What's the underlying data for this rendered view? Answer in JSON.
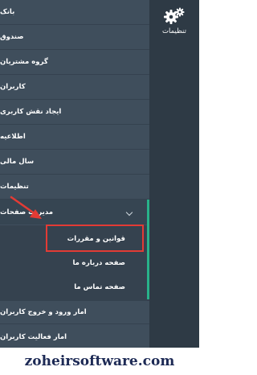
{
  "rail": {
    "icon": "gears-icon",
    "label": "تنظیمات"
  },
  "menu": {
    "items": [
      {
        "label": "بانک"
      },
      {
        "label": "صندوق"
      },
      {
        "label": "گروه مشتریان"
      },
      {
        "label": "کاربران"
      },
      {
        "label": "ایجاد نقش کاربری"
      },
      {
        "label": "اطلاعیه"
      },
      {
        "label": "سال مالی"
      },
      {
        "label": "تنظیمات"
      }
    ],
    "parent": {
      "label": "مدیریت صفحات",
      "icon": "chevron-down-icon"
    },
    "subitems": [
      {
        "label": "قوانین و مقررات"
      },
      {
        "label": "صفحه درباره ما"
      },
      {
        "label": "صفحه تماس ما"
      }
    ],
    "bottom_items": [
      {
        "label": "امار ورود و خروج کاربران"
      },
      {
        "label": "امار فعالیت کاربران"
      }
    ]
  },
  "watermark": "zoheirsoftware.com",
  "colors": {
    "menu_bg": "#3f4e5c",
    "rail_bg": "#2e3a45",
    "accent": "#28b28a",
    "highlight": "#e33b35"
  }
}
